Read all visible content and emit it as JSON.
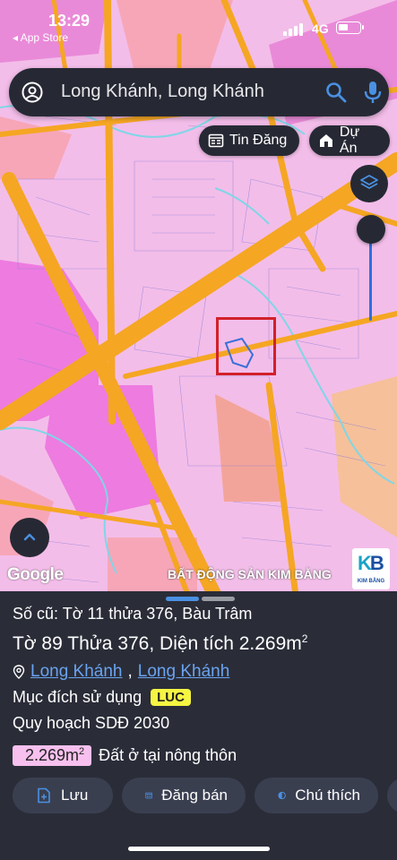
{
  "status_bar": {
    "time": "13:29",
    "back_label": "◂ App Store",
    "network": "4G"
  },
  "search": {
    "query": "Long Khánh, Long Khánh"
  },
  "chips": {
    "listings": "Tin Đăng",
    "projects": "Dự Án"
  },
  "map": {
    "attribution": "Google",
    "watermark": "BẤT ĐỘNG SẢN KIM BẰNG",
    "logo_mark_k": "K",
    "logo_mark_b": "B",
    "logo_name": "KIM BẰNG"
  },
  "parcel": {
    "old_info": "Số cũ: Tờ 11 thửa 376, Bàu Trâm",
    "main_info": "Tờ 89 Thửa 376, Diện tích 2.269m",
    "main_info_sup": "2",
    "location_link_1": "Long Khánh",
    "location_sep": ",",
    "location_link_2": "Long Khánh",
    "purpose_label": "Mục đích sử dụng",
    "purpose_code": "LUC",
    "plan_label": "Quy hoạch SDĐ 2030",
    "area_value": "2.269m",
    "area_sup": "2",
    "area_desc": "Đất ở tại nông thôn"
  },
  "actions": {
    "save": "Lưu",
    "sell": "Đăng bán",
    "legend": "Chú thích"
  },
  "colors": {
    "accent": "#4a90e2",
    "sheet_bg": "#2a2d38",
    "map_residential": "#f2b6e8",
    "map_road": "#f5a623",
    "highlight_box": "#d2202a",
    "badge_yellow": "#f5f542"
  }
}
